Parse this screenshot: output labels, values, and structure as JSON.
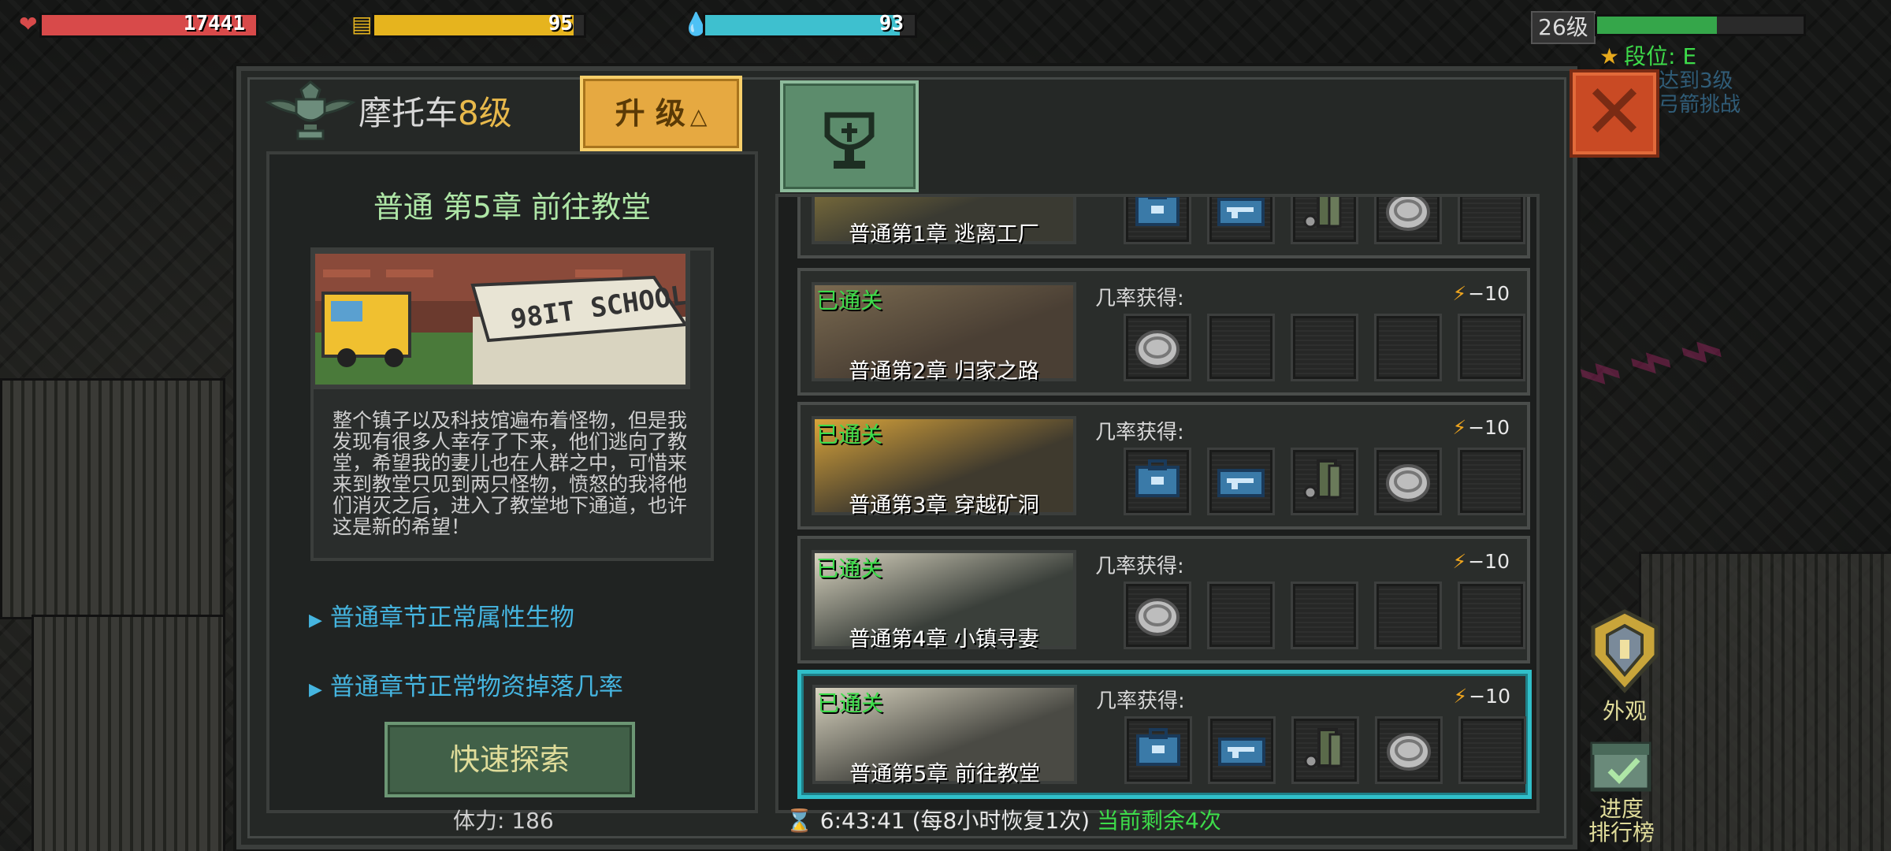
{
  "hud": {
    "hp": {
      "value": "17441",
      "fill": 1.0,
      "color": "#d84a4a"
    },
    "food": {
      "value": "95",
      "fill": 0.95,
      "color": "#e6b41e"
    },
    "water": {
      "value": "93",
      "fill": 0.93,
      "color": "#3ec0cf"
    },
    "level": "26级",
    "xp_fill": 0.58,
    "rank_label": "段位: E",
    "task_line1": "达到3级",
    "task_line2": "弓箭挑战"
  },
  "vehicle": {
    "name": "摩托车",
    "level": "8级"
  },
  "upgrade_label": "升 级",
  "selected": {
    "title": "普通 第5章 前往教堂",
    "description": "整个镇子以及科技馆遍布着怪物，但是我发现有很多人幸存了下来，他们逃向了教堂，希望我的妻儿也在人群之中，可惜来来到教堂只见到两只怪物，愤怒的我将他们消灭之后，进入了教堂地下通道，也许这是新的希望！",
    "sign_text": "98IT SCHOOL"
  },
  "links": [
    "普通章节正常属性生物",
    "普通章节正常物资掉落几率"
  ],
  "explore_label": "快速探索",
  "stamina": "体力: 186",
  "timer": {
    "time": "6:43:41 (每8小时恢复1次)",
    "remaining": "当前剩余4次"
  },
  "chapters": [
    {
      "name": "普通第1章 逃离工厂",
      "cleared": "",
      "drop_label": "",
      "energy": "",
      "items": [
        "case-icon",
        "gun-case-icon",
        "ammo-icon",
        "coin-icon",
        ""
      ]
    },
    {
      "name": "普通第2章 归家之路",
      "cleared": "已通关",
      "drop_label": "几率获得:",
      "energy": "−10",
      "items": [
        "coin-icon",
        "",
        "",
        "",
        ""
      ]
    },
    {
      "name": "普通第3章 穿越矿洞",
      "cleared": "已通关",
      "drop_label": "几率获得:",
      "energy": "−10",
      "items": [
        "case-icon",
        "gun-case-icon",
        "ammo-icon",
        "coin-icon",
        ""
      ]
    },
    {
      "name": "普通第4章 小镇寻妻",
      "cleared": "已通关",
      "drop_label": "几率获得:",
      "energy": "−10",
      "items": [
        "coin-icon",
        "",
        "",
        "",
        ""
      ]
    },
    {
      "name": "普通第5章 前往教堂",
      "cleared": "已通关",
      "drop_label": "几率获得:",
      "energy": "−10",
      "items": [
        "case-icon",
        "gun-case-icon",
        "ammo-icon",
        "coin-icon",
        ""
      ]
    }
  ],
  "side_buttons": {
    "appearance": "外观",
    "leaderboard": "进度\n排行榜"
  }
}
